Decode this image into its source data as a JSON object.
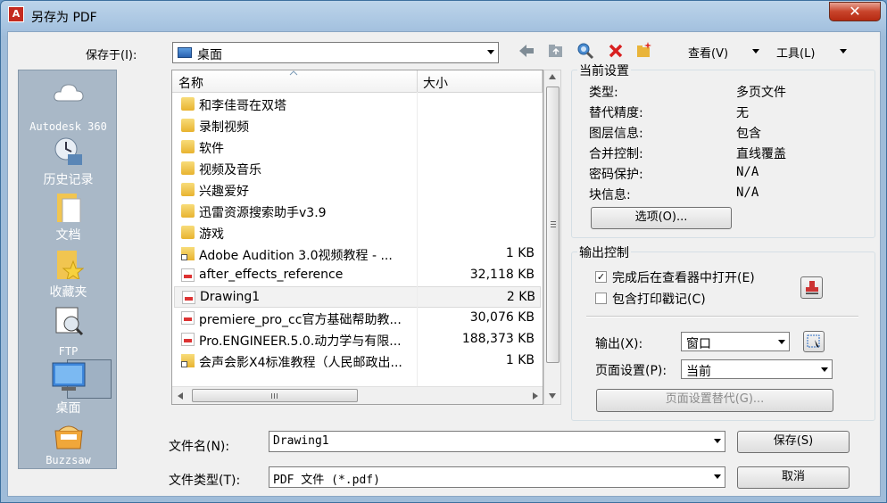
{
  "window": {
    "title": "另存为 PDF",
    "close_label": "✕"
  },
  "save_in": {
    "label": "保存于(I):",
    "value": "桌面"
  },
  "toolbar": {
    "view_label": "查看(V)",
    "tools_label": "工具(L)"
  },
  "places": [
    {
      "label": "Autodesk 360",
      "icon": "cloud-icon"
    },
    {
      "label": "历史记录",
      "icon": "history-icon"
    },
    {
      "label": "文档",
      "icon": "documents-icon"
    },
    {
      "label": "收藏夹",
      "icon": "favorites-icon"
    },
    {
      "label": "FTP",
      "icon": "ftp-icon"
    },
    {
      "label": "桌面",
      "icon": "desktop-icon"
    },
    {
      "label": "Buzzsaw",
      "icon": "buzzsaw-icon"
    }
  ],
  "file_list": {
    "col_name": "名称",
    "col_size": "大小",
    "rows": [
      {
        "name": "和李佳哥在双塔",
        "size": "",
        "type": "folder"
      },
      {
        "name": "录制视频",
        "size": "",
        "type": "folder"
      },
      {
        "name": "软件",
        "size": "",
        "type": "folder"
      },
      {
        "name": "视频及音乐",
        "size": "",
        "type": "folder"
      },
      {
        "name": "兴趣爱好",
        "size": "",
        "type": "folder"
      },
      {
        "name": "迅雷资源搜索助手v3.9",
        "size": "",
        "type": "folder"
      },
      {
        "name": "游戏",
        "size": "",
        "type": "folder"
      },
      {
        "name": "Adobe Audition 3.0视频教程 - ...",
        "size": "1 KB",
        "type": "link"
      },
      {
        "name": "after_effects_reference",
        "size": "32,118 KB",
        "type": "pdf"
      },
      {
        "name": "Drawing1",
        "size": "2 KB",
        "type": "pdf"
      },
      {
        "name": "premiere_pro_cc官方基础帮助教...",
        "size": "30,076 KB",
        "type": "pdf"
      },
      {
        "name": "Pro.ENGINEER.5.0.动力学与有限...",
        "size": "188,373 KB",
        "type": "pdf"
      },
      {
        "name": "会声会影X4标准教程（人民邮政出...",
        "size": "1 KB",
        "type": "link"
      }
    ]
  },
  "current_settings": {
    "title": "当前设置",
    "rows": [
      {
        "key": "类型:",
        "value": "多页文件"
      },
      {
        "key": "替代精度:",
        "value": "无"
      },
      {
        "key": "图层信息:",
        "value": "包含"
      },
      {
        "key": "合并控制:",
        "value": "直线覆盖"
      },
      {
        "key": "密码保护:",
        "value": "N/A"
      },
      {
        "key": "块信息:",
        "value": "N/A"
      }
    ],
    "options_button": "选项(O)..."
  },
  "output_control": {
    "title": "输出控制",
    "open_in_viewer": {
      "label": "完成后在查看器中打开(E)",
      "checked": "✓"
    },
    "include_stamp": {
      "label": "包含打印戳记(C)",
      "checked": ""
    },
    "output_label": "输出(X):",
    "output_value": "窗口",
    "page_setup_label": "页面设置(P):",
    "page_setup_value": "当前",
    "page_setup_override_button": "页面设置替代(G)..."
  },
  "filename": {
    "label": "文件名(N):",
    "value": "Drawing1"
  },
  "filetype": {
    "label": "文件类型(T):",
    "value": "PDF 文件 (*.pdf)"
  },
  "buttons": {
    "save": "保存(S)",
    "cancel": "取消"
  }
}
